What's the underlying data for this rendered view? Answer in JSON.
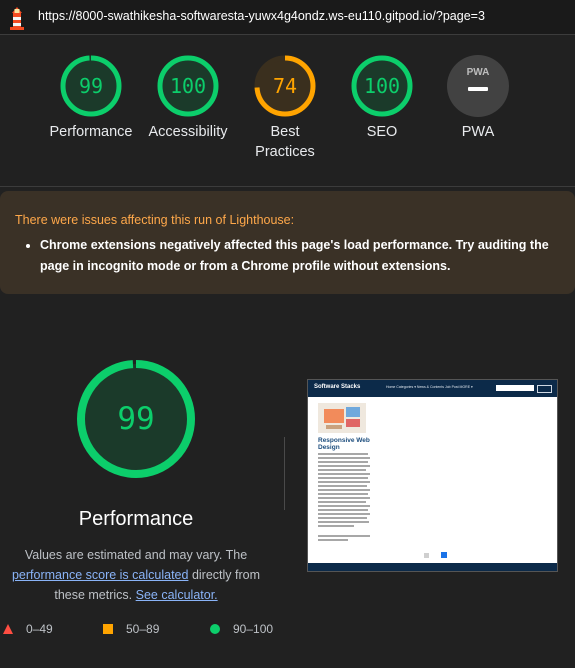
{
  "url": "https://8000-swathikesha-softwaresta-yuwx4g4ondz.ws-eu110.gitpod.io/?page=3",
  "categories": [
    {
      "label": "Performance",
      "score": "99",
      "color": "#0cce6b"
    },
    {
      "label": "Accessibility",
      "score": "100",
      "color": "#0cce6b"
    },
    {
      "label": "Best Practices",
      "score": "74",
      "color": "#ffa400"
    },
    {
      "label": "SEO",
      "score": "100",
      "color": "#0cce6b"
    },
    {
      "label": "PWA",
      "score": "",
      "color": "#9aa0a6"
    }
  ],
  "warning": {
    "title": "There were issues affecting this run of Lighthouse:",
    "items": [
      "Chrome extensions negatively affected this page's load performance. Try auditing the page in incognito mode or from a Chrome profile without extensions."
    ]
  },
  "performance": {
    "score": "99",
    "title": "Performance",
    "desc_prefix": "Values are estimated and may vary. The",
    "link_calc": "performance score is calculated",
    "desc_mid": "directly from these metrics.",
    "link_calculator": "See calculator."
  },
  "legend": [
    {
      "range": "0–49",
      "color": "#ff4e42",
      "shape": "triangle"
    },
    {
      "range": "50–89",
      "color": "#ffa400",
      "shape": "square"
    },
    {
      "range": "90–100",
      "color": "#0cce6b",
      "shape": "circle"
    }
  ],
  "screenshot": {
    "brand": "Software Stacks",
    "nav_links": "Home   Categories ▾   News & Contents   Job Post   MORE ▾",
    "card_title": "Responsive Web Design"
  },
  "icons": {
    "lighthouse": "lighthouse-icon",
    "pwa": "pwa-badge-icon"
  }
}
